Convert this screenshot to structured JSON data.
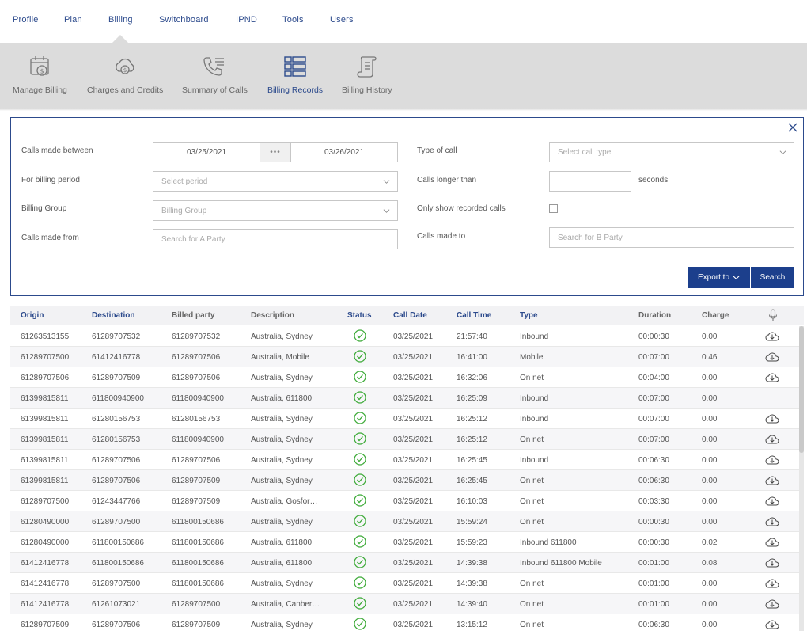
{
  "nav": {
    "tabs": [
      "Profile",
      "Plan",
      "Billing",
      "Switchboard",
      "IPND",
      "Tools",
      "Users"
    ],
    "active": "Billing"
  },
  "subnav": {
    "items": [
      {
        "label": "Manage Billing",
        "icon": "calendar-dollar-icon"
      },
      {
        "label": "Charges and Credits",
        "icon": "cloud-dollar-icon"
      },
      {
        "label": "Summary of Calls",
        "icon": "phone-list-icon"
      },
      {
        "label": "Billing Records",
        "icon": "records-list-icon"
      },
      {
        "label": "Billing History",
        "icon": "scroll-icon"
      }
    ],
    "active": "Billing Records"
  },
  "filters": {
    "calls_between_label": "Calls made between",
    "date_from": "03/25/2021",
    "date_to": "03/26/2021",
    "date_separator": "•••",
    "billing_period_label": "For billing period",
    "billing_period_placeholder": "Select period",
    "billing_group_label": "Billing Group",
    "billing_group_placeholder": "Billing Group",
    "calls_from_label": "Calls made from",
    "calls_from_placeholder": "Search for A Party",
    "type_label": "Type of call",
    "type_placeholder": "Select call type",
    "longer_label": "Calls longer than",
    "longer_value": "",
    "seconds_label": "seconds",
    "recorded_label": "Only show recorded calls",
    "recorded_checked": false,
    "calls_to_label": "Calls made to",
    "calls_to_placeholder": "Search for B Party",
    "export_label": "Export to",
    "search_label": "Search"
  },
  "table": {
    "columns": [
      "Origin",
      "Destination",
      "Billed party",
      "Description",
      "Status",
      "Call Date",
      "Call Time",
      "Type",
      "Duration",
      "Charge"
    ],
    "recording_icon": "microphone-icon",
    "rows": [
      {
        "origin": "61263513155",
        "destination": "61289707532",
        "billed": "61289707532",
        "description": "Australia, Sydney",
        "date": "03/25/2021",
        "time": "21:57:40",
        "type": "Inbound",
        "duration": "00:00:30",
        "charge": "0.00",
        "download": true
      },
      {
        "origin": "61289707500",
        "destination": "61412416778",
        "billed": "61289707506",
        "description": "Australia, Mobile",
        "date": "03/25/2021",
        "time": "16:41:00",
        "type": "Mobile",
        "duration": "00:07:00",
        "charge": "0.46",
        "download": true
      },
      {
        "origin": "61289707506",
        "destination": "61289707509",
        "billed": "61289707506",
        "description": "Australia, Sydney",
        "date": "03/25/2021",
        "time": "16:32:06",
        "type": "On net",
        "duration": "00:04:00",
        "charge": "0.00",
        "download": true
      },
      {
        "origin": "61399815811",
        "destination": "611800940900",
        "billed": "611800940900",
        "description": "Australia, 611800",
        "date": "03/25/2021",
        "time": "16:25:09",
        "type": "Inbound",
        "duration": "00:07:00",
        "charge": "0.00",
        "download": false
      },
      {
        "origin": "61399815811",
        "destination": "61280156753",
        "billed": "61280156753",
        "description": "Australia, Sydney",
        "date": "03/25/2021",
        "time": "16:25:12",
        "type": "Inbound",
        "duration": "00:07:00",
        "charge": "0.00",
        "download": true
      },
      {
        "origin": "61399815811",
        "destination": "61280156753",
        "billed": "611800940900",
        "description": "Australia, Sydney",
        "date": "03/25/2021",
        "time": "16:25:12",
        "type": "On net",
        "duration": "00:07:00",
        "charge": "0.00",
        "download": true
      },
      {
        "origin": "61399815811",
        "destination": "61289707506",
        "billed": "61289707506",
        "description": "Australia, Sydney",
        "date": "03/25/2021",
        "time": "16:25:45",
        "type": "Inbound",
        "duration": "00:06:30",
        "charge": "0.00",
        "download": true
      },
      {
        "origin": "61399815811",
        "destination": "61289707506",
        "billed": "61289707509",
        "description": "Australia, Sydney",
        "date": "03/25/2021",
        "time": "16:25:45",
        "type": "On net",
        "duration": "00:06:30",
        "charge": "0.00",
        "download": true
      },
      {
        "origin": "61289707500",
        "destination": "61243447766",
        "billed": "61289707509",
        "description": "Australia, Gosfor…",
        "date": "03/25/2021",
        "time": "16:10:03",
        "type": "On net",
        "duration": "00:03:30",
        "charge": "0.00",
        "download": true
      },
      {
        "origin": "61280490000",
        "destination": "61289707500",
        "billed": "611800150686",
        "description": "Australia, Sydney",
        "date": "03/25/2021",
        "time": "15:59:24",
        "type": "On net",
        "duration": "00:00:30",
        "charge": "0.00",
        "download": true
      },
      {
        "origin": "61280490000",
        "destination": "611800150686",
        "billed": "611800150686",
        "description": "Australia, 611800",
        "date": "03/25/2021",
        "time": "15:59:23",
        "type": "Inbound 611800",
        "duration": "00:00:30",
        "charge": "0.02",
        "download": true
      },
      {
        "origin": "61412416778",
        "destination": "611800150686",
        "billed": "611800150686",
        "description": "Australia, 611800",
        "date": "03/25/2021",
        "time": "14:39:38",
        "type": "Inbound 611800 Mobile",
        "duration": "00:01:00",
        "charge": "0.08",
        "download": true
      },
      {
        "origin": "61412416778",
        "destination": "61289707500",
        "billed": "611800150686",
        "description": "Australia, Sydney",
        "date": "03/25/2021",
        "time": "14:39:38",
        "type": "On net",
        "duration": "00:01:00",
        "charge": "0.00",
        "download": true
      },
      {
        "origin": "61412416778",
        "destination": "61261073021",
        "billed": "61289707500",
        "description": "Australia, Canber…",
        "date": "03/25/2021",
        "time": "14:39:40",
        "type": "On net",
        "duration": "00:01:00",
        "charge": "0.00",
        "download": true
      },
      {
        "origin": "61289707509",
        "destination": "61289707506",
        "billed": "61289707509",
        "description": "Australia, Sydney",
        "date": "03/25/2021",
        "time": "13:15:12",
        "type": "On net",
        "duration": "00:06:30",
        "charge": "0.00",
        "download": true
      }
    ]
  },
  "colors": {
    "brand": "#2c4a8c",
    "button": "#1c3f8c",
    "status_ok": "#3aa935",
    "subnav_bg": "#dcdcdc"
  }
}
